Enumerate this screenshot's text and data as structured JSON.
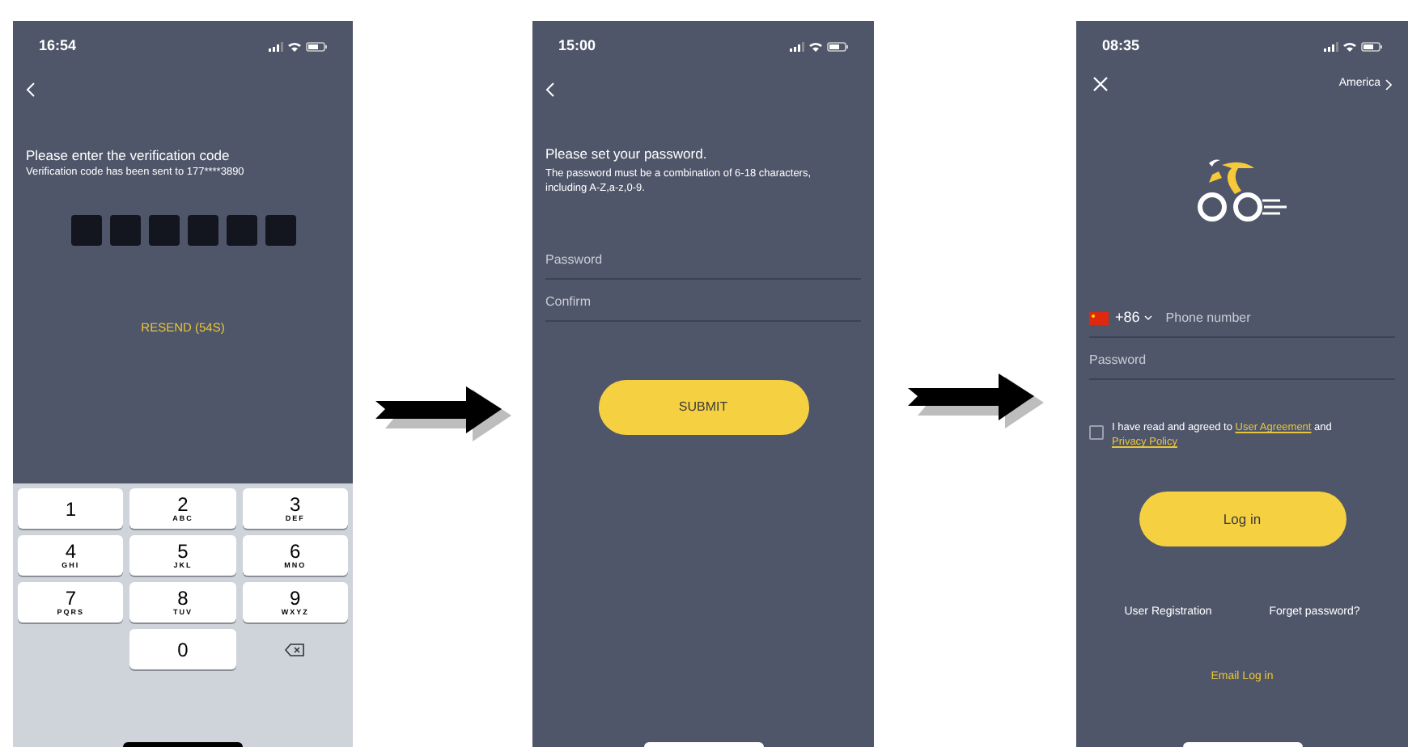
{
  "screens": [
    {
      "kind": "verify",
      "time": "16:54",
      "title": "Please enter the verification code",
      "subtitle": "Verification code has been sent to 177****3890",
      "code_boxes": [
        {
          "filled": false
        },
        {
          "filled": false
        },
        {
          "filled": false
        },
        {
          "filled": false
        },
        {
          "filled": false
        },
        {
          "filled": false
        }
      ],
      "resend": "RESEND (54S)",
      "keypad": [
        {
          "kind": "digit",
          "digit": "1"
        },
        {
          "kind": "digit",
          "digit": "2",
          "letters": "ABC"
        },
        {
          "kind": "digit",
          "digit": "3",
          "letters": "DEF"
        },
        {
          "kind": "digit",
          "digit": "4",
          "letters": "GHI"
        },
        {
          "kind": "digit",
          "digit": "5",
          "letters": "JKL"
        },
        {
          "kind": "digit",
          "digit": "6",
          "letters": "MNO"
        },
        {
          "kind": "digit",
          "digit": "7",
          "letters": "PQRS"
        },
        {
          "kind": "digit",
          "digit": "8",
          "letters": "TUV"
        },
        {
          "kind": "digit",
          "digit": "9",
          "letters": "WXYZ"
        },
        {
          "kind": "blank"
        },
        {
          "kind": "digit",
          "digit": "0"
        },
        {
          "kind": "delete"
        }
      ]
    },
    {
      "kind": "password",
      "time": "15:00",
      "title": "Please set your password.",
      "subtitle": "The password must be a combination of 6-18 characters, including A-Z,a-z,0-9.",
      "fields": [
        {
          "placeholder": "Password"
        },
        {
          "placeholder": "Confirm"
        }
      ],
      "button": "SUBMIT"
    },
    {
      "kind": "login",
      "time": "08:35",
      "region": "America",
      "country_code": "+86",
      "phone_placeholder": "Phone number",
      "password_placeholder": "Password",
      "agreement": {
        "checked": false,
        "text": "I have read and agreed to",
        "link_1": "User Agreement",
        "joiner": "and",
        "link_2": "Privacy Policy"
      },
      "button": "Log in",
      "links": [
        "User Registration",
        "Forget password?"
      ],
      "email_login": "Email Log in"
    }
  ]
}
